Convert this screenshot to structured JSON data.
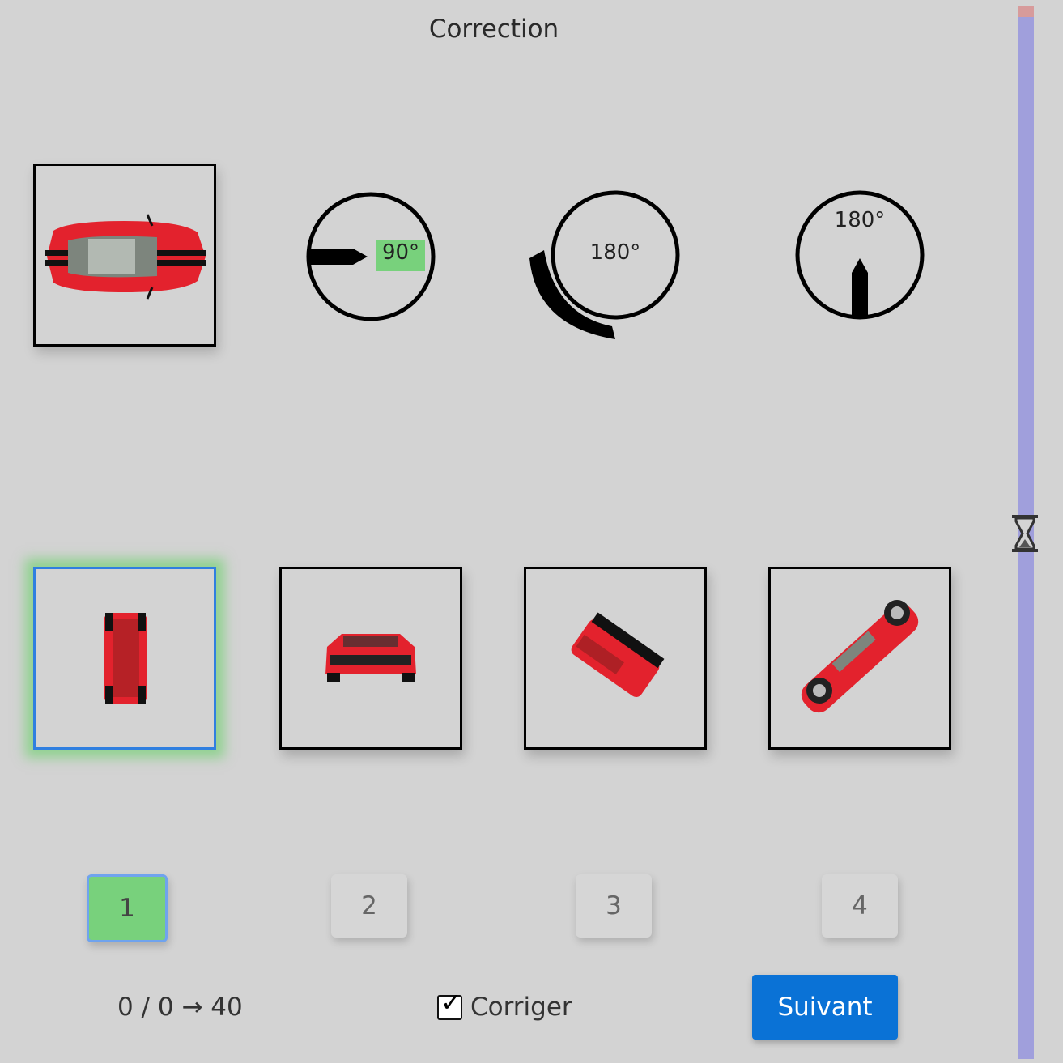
{
  "header": {
    "title": "Correction"
  },
  "instructions": {
    "dial_1_label": "90°",
    "dial_2_label": "180°",
    "dial_3_label": "180°"
  },
  "icons": [
    "car-top-view-image",
    "rotate-left-arrow-icon",
    "rotate-ccw-arrow-icon",
    "up-arrow-icon",
    "hourglass-icon",
    "checkbox-checked-icon"
  ],
  "choices": [
    {
      "label": "1",
      "selected": true
    },
    {
      "label": "2",
      "selected": false
    },
    {
      "label": "3",
      "selected": false
    },
    {
      "label": "4",
      "selected": false
    }
  ],
  "footer": {
    "counter": "0 / 0 → 40",
    "checkbox_label": "Corriger",
    "checkbox_checked": true,
    "next_label": "Suivant"
  },
  "timer": {
    "elapsed_fraction": 0.01
  },
  "colors": {
    "background": "#d3d3d3",
    "highlight_green": "#78d17c",
    "selection_blue": "#2f7fe0",
    "button_blue": "#0a72d6",
    "timer_track": "#a09fdc",
    "timer_elapsed": "#d79b9b",
    "car_red": "#e3222d"
  }
}
